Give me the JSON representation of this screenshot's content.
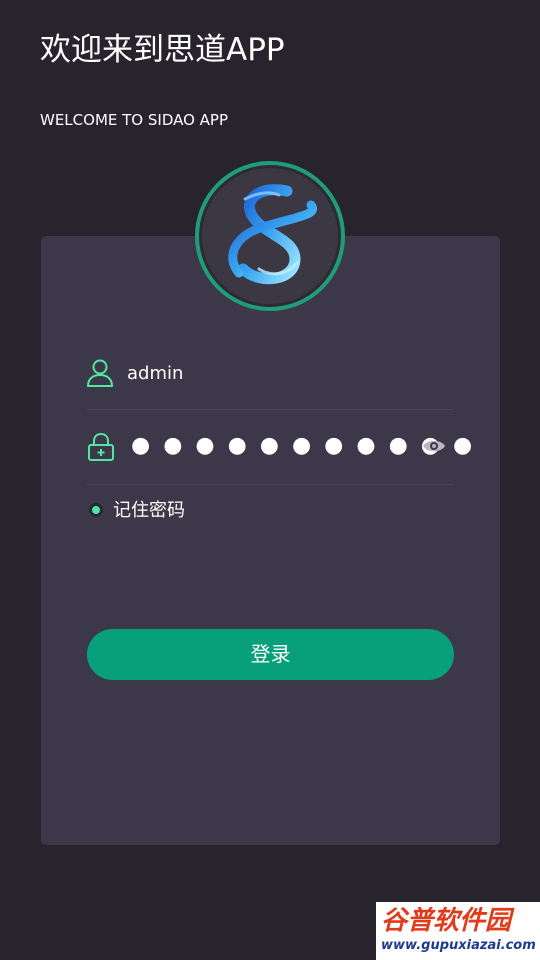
{
  "header": {
    "title": "欢迎来到思道APP",
    "subtitle": "WELCOME TO SIDAO APP"
  },
  "logo": {
    "icon": "sidao-logo-icon"
  },
  "form": {
    "username": {
      "icon": "user-icon",
      "value": "admin"
    },
    "password": {
      "icon": "lock-icon",
      "masked_value": "●●●●●●●●●●●",
      "visibility_icon": "eye-icon"
    },
    "remember": {
      "label": "记住密码",
      "checked": true
    },
    "login_label": "登录"
  },
  "watermark": {
    "brand": "谷普软件园",
    "url": "www.gupuxiazai.com"
  },
  "colors": {
    "background": "#28242d",
    "card": "#3d3849",
    "accent": "#07a07a",
    "icon_green": "#4ee8a2"
  }
}
